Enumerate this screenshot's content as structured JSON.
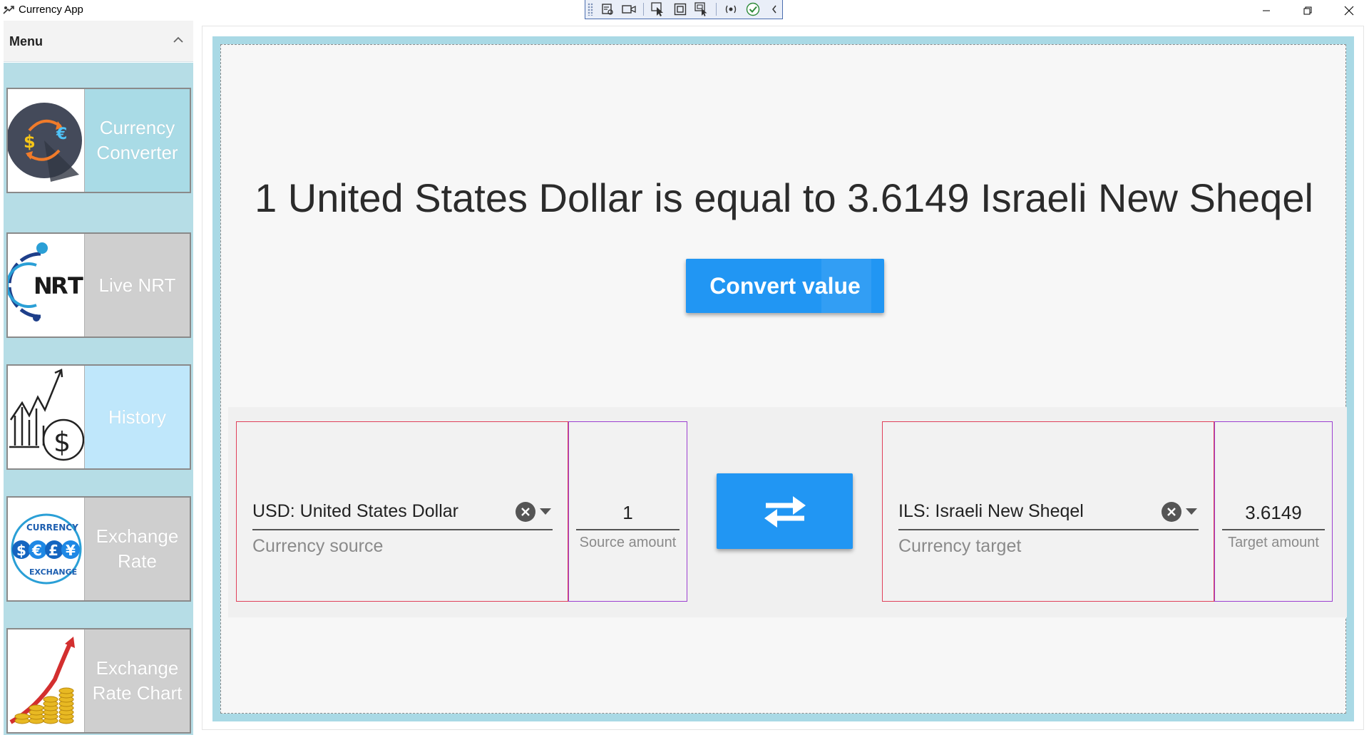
{
  "window": {
    "title": "Currency App",
    "controls": [
      "minimize",
      "restore",
      "close"
    ]
  },
  "debug_toolbar": {
    "icons": [
      "live-visual-tree-icon",
      "record-icon",
      "select-element-icon",
      "display-layout-adorners-icon",
      "track-focus-icon",
      "hot-reload-icon",
      "check-icon",
      "collapse-chevron-icon"
    ]
  },
  "sidebar": {
    "title": "Menu",
    "items": [
      {
        "label_line1": "Currency",
        "label_line2": "Converter",
        "image": "currency-converter-image",
        "state": "selected",
        "color": "#a9dbe6"
      },
      {
        "label_line1": "Live NRT",
        "label_line2": "",
        "image": "nrt-image",
        "state": "normal",
        "color": "#cfcfcf"
      },
      {
        "label_line1": "History",
        "label_line2": "",
        "image": "history-image",
        "state": "hover",
        "color": "#bfe7fb"
      },
      {
        "label_line1": "Exchange",
        "label_line2": "Rate",
        "image": "exchange-image",
        "state": "normal",
        "color": "#cfcfcf"
      },
      {
        "label_line1": "Exchange",
        "label_line2": "Rate Chart",
        "image": "chart-image",
        "state": "normal",
        "color": "#cfcfcf"
      }
    ]
  },
  "main": {
    "result_text": "1 United States Dollar is equal to 3.6149 Israeli New Sheqel",
    "convert_label": "Convert value",
    "source": {
      "currency_value": "USD: United States Dollar",
      "currency_hint": "Currency source",
      "amount_value": "1",
      "amount_hint": "Source amount"
    },
    "target": {
      "currency_value": "ILS: Israeli New Sheqel",
      "currency_hint": "Currency target",
      "amount_value": "3.6149",
      "amount_hint": "Target amount"
    },
    "accent_color": "#2196f3"
  }
}
